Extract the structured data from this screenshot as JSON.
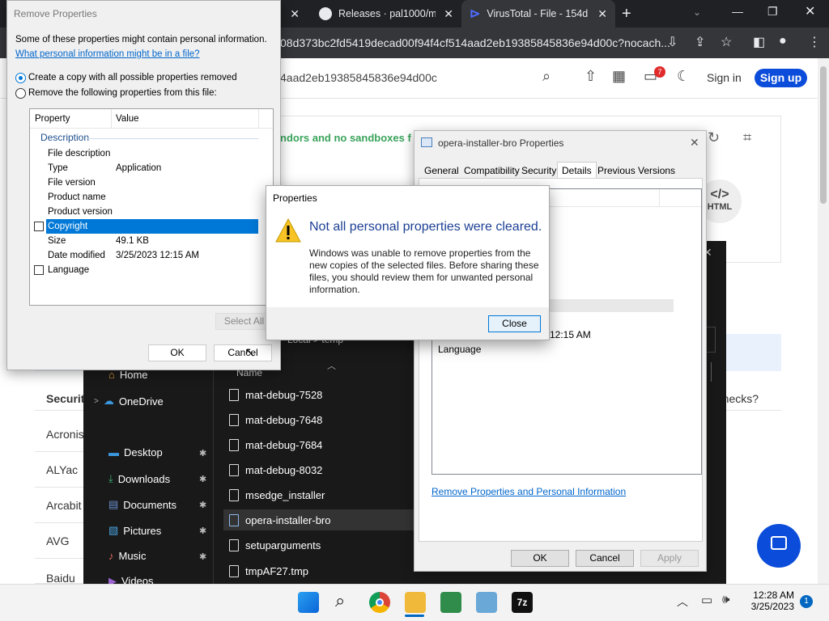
{
  "chrome": {
    "tabs": [
      {
        "label": "Releases · pal1000/me"
      },
      {
        "label": "VirusTotal - File - 154d"
      }
    ],
    "new_tab": "+",
    "url": "08d373bc2fd5419decad00f94f4cf514aad2eb19385845836e94d00c?nocach..."
  },
  "vt": {
    "hash": "4aad2eb19385845836e94d00c",
    "sign_in": "Sign in",
    "sign_up": "Sign up",
    "notif_count": "7",
    "green_text": "ndors and no sandboxes f",
    "html_badge": "HTML",
    "section": "Security",
    "question": "e checks?",
    "vendors": [
      "Acronis",
      "ALYac",
      "Arcabit",
      "AVG",
      "Baidu"
    ]
  },
  "explorer": {
    "breadcrumb": [
      "Local",
      ">",
      "temp"
    ],
    "column_name": "Name",
    "nav": [
      {
        "label": "Home",
        "icon": "home-icon"
      },
      {
        "label": "OneDrive",
        "icon": "cloud-icon"
      },
      {
        "label": "Desktop",
        "icon": "desktop-icon"
      },
      {
        "label": "Downloads",
        "icon": "download-icon"
      },
      {
        "label": "Documents",
        "icon": "documents-icon"
      },
      {
        "label": "Pictures",
        "icon": "pictures-icon"
      },
      {
        "label": "Music",
        "icon": "music-icon"
      },
      {
        "label": "Videos",
        "icon": "videos-icon"
      }
    ],
    "files": [
      "mat-debug-7528",
      "mat-debug-7648",
      "mat-debug-7684",
      "mat-debug-8032",
      "msedge_installer",
      "opera-installer-bro",
      "setuparguments",
      "tmpAF27.tmp"
    ],
    "selected_file": "opera-installer-bro"
  },
  "props": {
    "title": "opera-installer-bro Properties",
    "tabs": [
      "General",
      "Compatibility",
      "Security",
      "Details",
      "Previous Versions"
    ],
    "active_tab": "Details",
    "time_fragment": "12:15 AM",
    "language": "Language",
    "link": "Remove Properties and Personal Information",
    "ok": "OK",
    "cancel": "Cancel",
    "apply": "Apply"
  },
  "remove": {
    "title": "Remove Properties",
    "intro": "Some of these properties might contain personal information.",
    "link": "What personal information might be in a file?",
    "option1": "Create a copy with all possible properties removed",
    "option2": "Remove the following properties from this file:",
    "col_property": "Property",
    "col_value": "Value",
    "group": "Description",
    "rows": [
      {
        "k": "File description",
        "v": ""
      },
      {
        "k": "Type",
        "v": "Application"
      },
      {
        "k": "File version",
        "v": ""
      },
      {
        "k": "Product name",
        "v": ""
      },
      {
        "k": "Product version",
        "v": ""
      },
      {
        "k": "Copyright",
        "v": ""
      },
      {
        "k": "Size",
        "v": "49.1 KB"
      },
      {
        "k": "Date modified",
        "v": "3/25/2023 12:15 AM"
      },
      {
        "k": "Language",
        "v": ""
      }
    ],
    "select_all": "Select All",
    "ok": "OK",
    "cancel": "Cancel"
  },
  "dialog": {
    "title": "Properties",
    "heading": "Not all personal properties were cleared.",
    "body": "Windows was unable to remove properties from the new copies of the selected files. Before sharing these files, you should review them for unwanted personal information.",
    "close": "Close"
  },
  "taskbar": {
    "time": "12:28 AM",
    "date": "3/25/2023",
    "badge": "1"
  },
  "colors": {
    "vt_blue": "#0b4dda",
    "selection": "#0078d7",
    "link": "#0066cc"
  }
}
